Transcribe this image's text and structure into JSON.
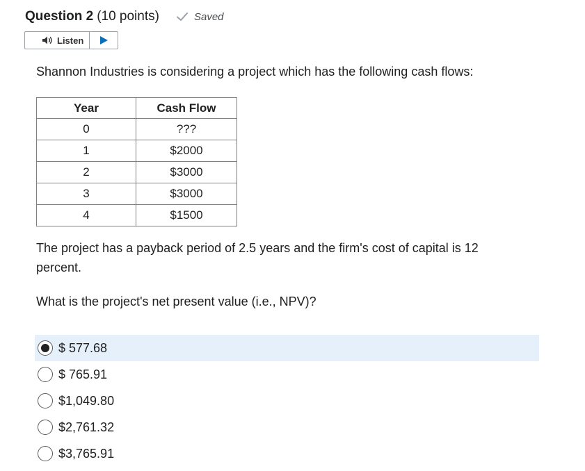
{
  "question": {
    "title": "Question 2",
    "points": "(10 points)",
    "status": "Saved"
  },
  "listen": {
    "label": "Listen"
  },
  "intro": "Shannon Industries is considering a project which has the following cash flows:",
  "table": {
    "headers": [
      "Year",
      "Cash Flow"
    ],
    "rows": [
      [
        "0",
        "???"
      ],
      [
        "1",
        "$2000"
      ],
      [
        "2",
        "$3000"
      ],
      [
        "3",
        "$3000"
      ],
      [
        "4",
        "$1500"
      ]
    ]
  },
  "paragraph1": "The project has a payback period of 2.5 years and the firm's cost of capital is 12 percent.",
  "paragraph2": "What is the project's net present value (i.e., NPV)?",
  "options": [
    {
      "label": "$ 577.68",
      "selected": true
    },
    {
      "label": "$ 765.91",
      "selected": false
    },
    {
      "label": "$1,049.80",
      "selected": false
    },
    {
      "label": "$2,761.32",
      "selected": false
    },
    {
      "label": "$3,765.91",
      "selected": false
    }
  ],
  "colors": {
    "selected_bg": "#e6f0fb",
    "text": "#202122",
    "check": "#9aa0a6"
  }
}
